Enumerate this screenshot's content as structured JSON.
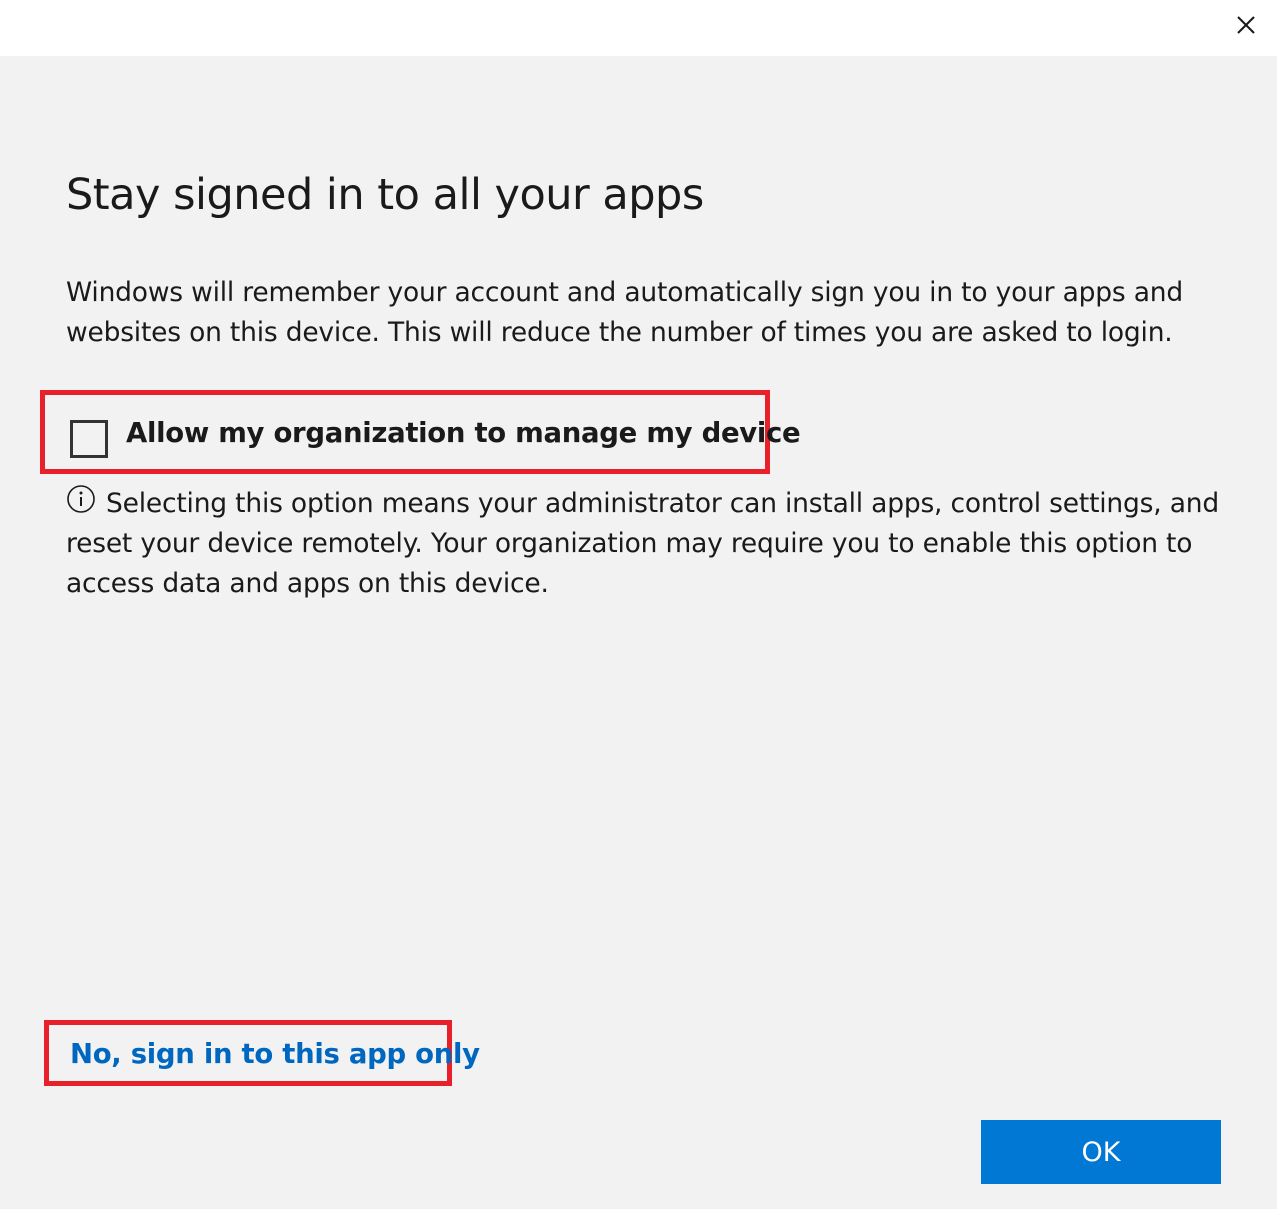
{
  "dialog": {
    "title": "Stay signed in to all your apps",
    "description": "Windows will remember your account and automatically sign you in to your apps and websites on this device. This will reduce the number of times you are asked to login.",
    "checkbox": {
      "label": "Allow my organization to manage my device",
      "checked": false
    },
    "info_text": "Selecting this option means your administrator can install apps, control settings, and reset your device remotely. Your organization may require you to enable this option to access data and apps on this device.",
    "link_label": "No, sign in to this app only",
    "ok_label": "OK"
  },
  "icons": {
    "close": "close-icon",
    "info": "info-icon"
  },
  "colors": {
    "accent": "#0078d4",
    "link": "#0067c0",
    "highlight": "#e8202a",
    "background": "#f2f2f2"
  }
}
